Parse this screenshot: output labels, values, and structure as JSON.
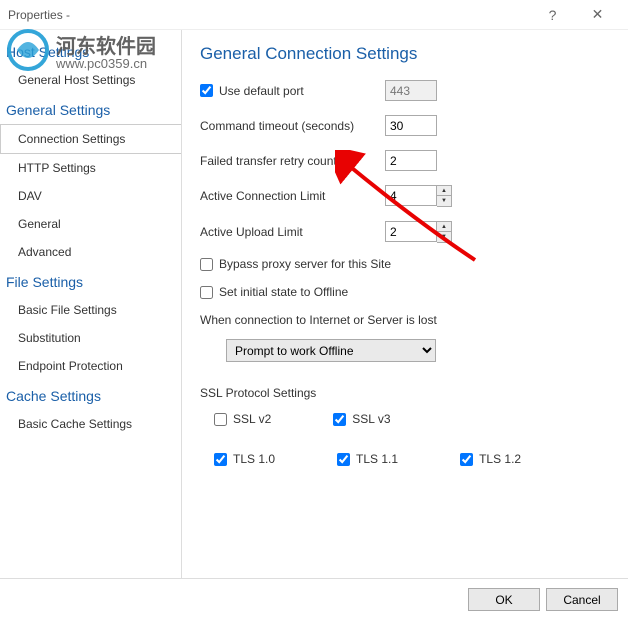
{
  "window": {
    "title": "Properties -",
    "help": "?",
    "close": "✕"
  },
  "sidebar": {
    "sections": [
      {
        "header": "Host Settings",
        "items": [
          {
            "label": "General Host Settings",
            "sel": false
          }
        ]
      },
      {
        "header": "General Settings",
        "items": [
          {
            "label": "Connection Settings",
            "sel": true
          },
          {
            "label": "HTTP Settings",
            "sel": false
          },
          {
            "label": "DAV",
            "sel": false
          },
          {
            "label": "General",
            "sel": false
          },
          {
            "label": "Advanced",
            "sel": false
          }
        ]
      },
      {
        "header": "File Settings",
        "items": [
          {
            "label": "Basic File Settings",
            "sel": false
          },
          {
            "label": "Substitution",
            "sel": false
          },
          {
            "label": "Endpoint Protection",
            "sel": false
          }
        ]
      },
      {
        "header": "Cache Settings",
        "items": [
          {
            "label": "Basic Cache Settings",
            "sel": false
          }
        ]
      }
    ]
  },
  "main": {
    "title": "General Connection Settings",
    "use_default_port_label": "Use default port",
    "use_default_port_checked": true,
    "port_value": "443",
    "cmd_timeout_label": "Command timeout (seconds)",
    "cmd_timeout_value": "30",
    "retry_label": "Failed transfer retry count:",
    "retry_value": "2",
    "conn_limit_label": "Active Connection Limit",
    "conn_limit_value": "4",
    "upload_limit_label": "Active Upload Limit",
    "upload_limit_value": "2",
    "bypass_label": "Bypass proxy server for this Site",
    "bypass_checked": false,
    "offline_label": "Set initial state to Offline",
    "offline_checked": false,
    "lost_label": "When connection to Internet or Server is lost",
    "lost_selected": "Prompt to work Offline",
    "ssl_header": "SSL Protocol Settings",
    "ssl": {
      "sslv2": {
        "label": "SSL v2",
        "checked": false
      },
      "sslv3": {
        "label": "SSL v3",
        "checked": true
      },
      "tls10": {
        "label": "TLS 1.0",
        "checked": true
      },
      "tls11": {
        "label": "TLS 1.1",
        "checked": true
      },
      "tls12": {
        "label": "TLS 1.2",
        "checked": true
      }
    }
  },
  "footer": {
    "ok": "OK",
    "cancel": "Cancel"
  },
  "watermark": {
    "cn": "河东软件园",
    "url": "www.pc0359.cn"
  }
}
